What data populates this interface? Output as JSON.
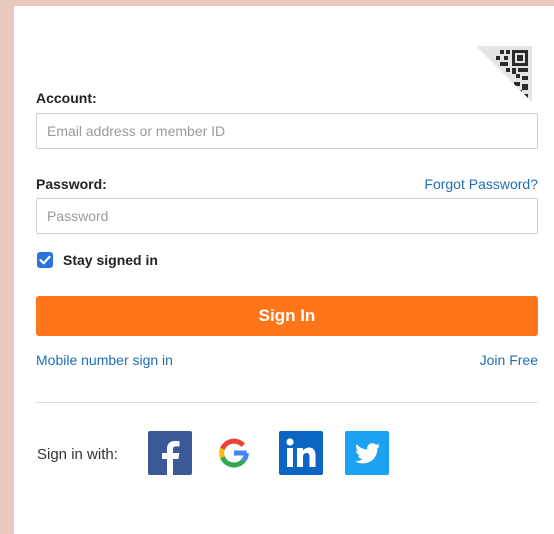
{
  "form": {
    "account_label": "Account:",
    "account_placeholder": "Email address or member ID",
    "account_value": "",
    "password_label": "Password:",
    "password_placeholder": "Password",
    "password_value": "",
    "forgot_password": "Forgot Password?",
    "stay_signed_in": "Stay signed in",
    "stay_signed_in_checked": true,
    "sign_in_button": "Sign In",
    "mobile_sign_in": "Mobile number sign in",
    "join_free": "Join Free"
  },
  "social": {
    "label": "Sign in with:",
    "providers": [
      {
        "name": "Facebook",
        "icon": "facebook-icon",
        "color": "#3b5998"
      },
      {
        "name": "Google",
        "icon": "google-icon",
        "color": "#ffffff"
      },
      {
        "name": "LinkedIn",
        "icon": "linkedin-icon",
        "color": "#0a66c2"
      },
      {
        "name": "Twitter",
        "icon": "twitter-icon",
        "color": "#1da1f2"
      }
    ]
  },
  "qr_login": {
    "icon": "qr-code-icon"
  },
  "colors": {
    "accent": "#ff7519",
    "link": "#1f6fb2",
    "checkbox": "#2a73d9",
    "background": "#e9c9bd"
  }
}
